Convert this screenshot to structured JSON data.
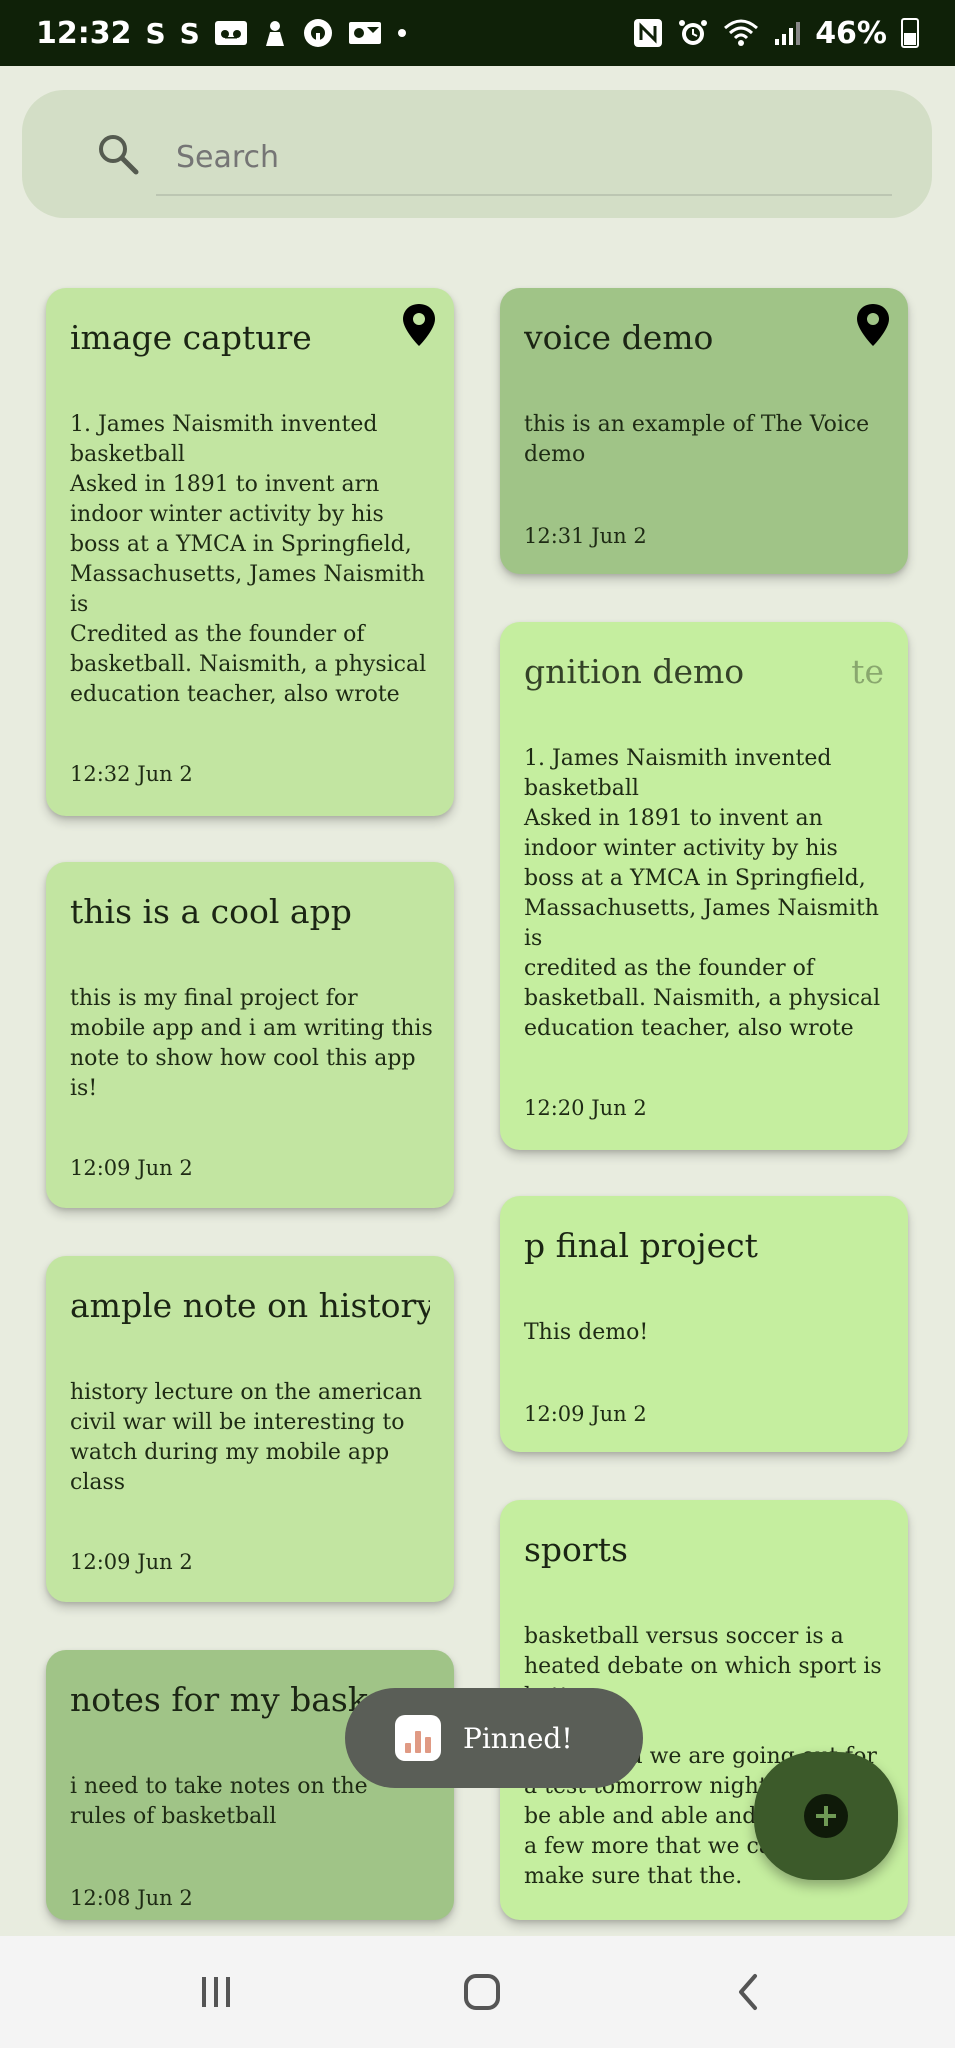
{
  "status_bar": {
    "time": "12:32",
    "left_icons": [
      "S",
      "S"
    ],
    "battery": "46%"
  },
  "search": {
    "placeholder": "Search"
  },
  "notes": [
    {
      "title": "image capture",
      "body": "1. James Naismith invented\nbasketball\nAsked in 1891 to invent arn\nindoor winter activity by his\nboss at a YMCA in Springfield,\nMassachusetts, James Naismith\nis\nCredited as the founder of\nbasketball. Naismith, a physical\neducation teacher, also wrote",
      "time": "12:32 Jun 2",
      "pinned": true
    },
    {
      "title": "voice demo",
      "body": "this is an example of The Voice\ndemo",
      "time": "12:31 Jun 2",
      "pinned": true
    },
    {
      "title": "gnition demo",
      "title_trail": "te",
      "body": "1. James Naismith invented\nbasketball\nAsked in 1891 to invent an\nindoor winter activity by his\nboss at a YMCA in Springfield,\nMassachusetts, James Naismith\nis\ncredited as the founder of\nbasketball. Naismith, a physical\neducation teacher, also wrote",
      "time": "12:20 Jun 2"
    },
    {
      "title": "this is a cool app",
      "body": "this is my final project for\nmobile app and i am writing this\nnote to show how cool this app\nis!",
      "time": "12:09 Jun 2"
    },
    {
      "title": "p final project",
      "body": "This demo!",
      "time": "12:09 Jun 2"
    },
    {
      "title": "ample note on history",
      "body": "history lecture on the american\ncivil war will be interesting to\nwatch during my mobile app\nclass",
      "time": "12:09 Jun 2"
    },
    {
      "title": "sports",
      "body": "basketball versus soccer is a\nheated debate on which sport is\nbetter.\n\nthistle and we are going out for\na test tomorrow night\nbe able and able and w\na few more that we ca\nmake sure that the.",
      "time": ""
    },
    {
      "title": "notes for my bask",
      "body": "i need to take notes on the\nrules of basketball",
      "time": "12:08 Jun 2"
    }
  ],
  "toast": {
    "text": "Pinned!"
  },
  "colors": {
    "status_bar": "#0f2108",
    "background": "#e8ecdf",
    "note_light": "#c5ee9f",
    "note_dark": "#a0c487",
    "fab": "#3c5a2a"
  }
}
